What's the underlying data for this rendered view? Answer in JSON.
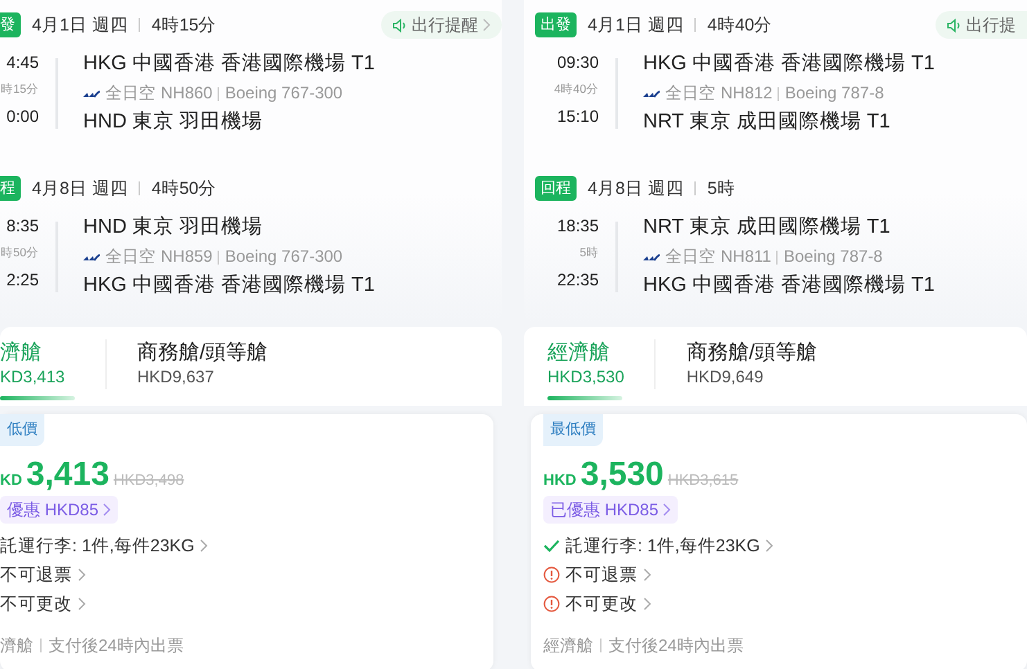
{
  "panels": [
    {
      "reminder": {
        "text": "出行提醒",
        "arrow": true
      },
      "segments": [
        {
          "badge": "發",
          "date": "4月1日 週四",
          "duration": "4時15分",
          "depart_time": "4:45",
          "flight_time": "時15分",
          "arrive_time": "0:00",
          "from": "HKG 中國香港 香港國際機場 T1",
          "airline": "全日空",
          "flight_no": "NH860",
          "aircraft": "Boeing 767-300",
          "to": "HND 東京 羽田機場"
        },
        {
          "badge": "程",
          "date": "4月8日 週四",
          "duration": "4時50分",
          "depart_time": "8:35",
          "flight_time": "時50分",
          "arrive_time": "2:25",
          "from": "HND 東京 羽田機場",
          "airline": "全日空",
          "flight_no": "NH859",
          "aircraft": "Boeing 767-300",
          "to": "HKG 中國香港 香港國際機場 T1"
        }
      ],
      "cabins": [
        {
          "name": "濟艙",
          "price": "KD3,413",
          "selected": true
        },
        {
          "name": "商務艙/頭等艙",
          "price": "HKD9,637",
          "selected": false
        }
      ],
      "fare": {
        "tag": "低價",
        "currency": "KD",
        "price": "3,413",
        "original_price": "HKD3,498",
        "discount": "優惠 HKD85",
        "rules": [
          {
            "text": "託運行李: 1件,每件23KG"
          },
          {
            "text": "不可退票"
          },
          {
            "text": "不可更改"
          }
        ],
        "cabin": "濟艙",
        "ticketing": "支付後24時內出票"
      }
    },
    {
      "reminder": {
        "text": "出行提",
        "arrow": false
      },
      "segments": [
        {
          "badge": "出發",
          "date": "4月1日 週四",
          "duration": "4時40分",
          "depart_time": "09:30",
          "flight_time": "4時40分",
          "arrive_time": "15:10",
          "from": "HKG 中國香港 香港國際機場 T1",
          "airline": "全日空",
          "flight_no": "NH812",
          "aircraft": "Boeing 787-8",
          "to": "NRT 東京 成田國際機場 T1"
        },
        {
          "badge": "回程",
          "date": "4月8日 週四",
          "duration": "5時",
          "depart_time": "18:35",
          "flight_time": "5時",
          "arrive_time": "22:35",
          "from": "NRT 東京 成田國際機場 T1",
          "airline": "全日空",
          "flight_no": "NH811",
          "aircraft": "Boeing 787-8",
          "to": "HKG 中國香港 香港國際機場 T1"
        }
      ],
      "cabins": [
        {
          "name": "經濟艙",
          "price": "HKD3,530",
          "selected": true
        },
        {
          "name": "商務艙/頭等艙",
          "price": "HKD9,649",
          "selected": false
        }
      ],
      "fare": {
        "tag": "最低價",
        "currency": "HKD",
        "price": "3,530",
        "original_price": "HKD3,615",
        "discount": "已優惠 HKD85",
        "rules": [
          {
            "kind": "check",
            "text": "託運行李: 1件,每件23KG"
          },
          {
            "kind": "warning",
            "text": "不可退票"
          },
          {
            "kind": "warning",
            "text": "不可更改"
          }
        ],
        "cabin": "經濟艙",
        "ticketing": "支付後24時內出票"
      }
    }
  ]
}
